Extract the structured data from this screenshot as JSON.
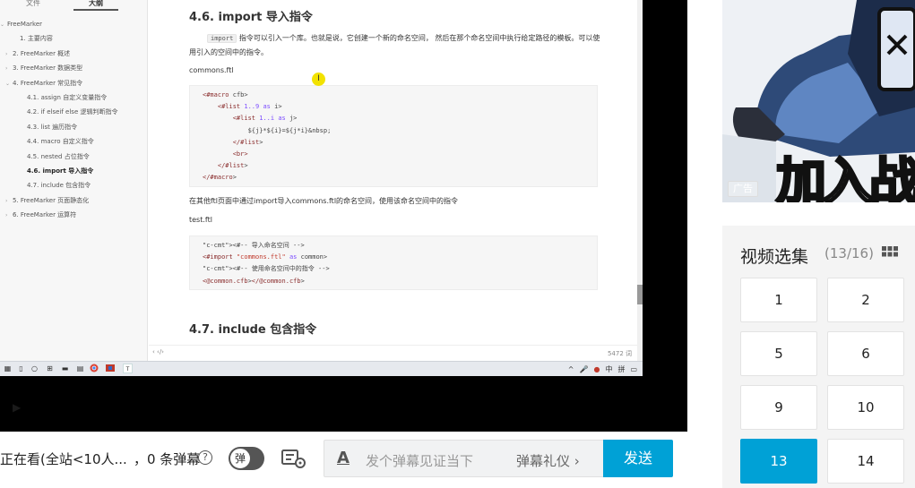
{
  "outline": {
    "tabs": [
      "文件",
      "大纲"
    ],
    "items": [
      {
        "label": "FreeMarker",
        "caret": "⌄"
      },
      {
        "label": "1. 主要内容",
        "caret": ""
      },
      {
        "label": "2. FreeMarker 概述",
        "caret": "›"
      },
      {
        "label": "3. FreeMarker 数据类型",
        "caret": "›"
      },
      {
        "label": "4. FreeMarker 常见指令",
        "caret": "⌄"
      },
      {
        "label": "4.1. assign 自定义变量指令",
        "caret": ""
      },
      {
        "label": "4.2. if elseif else 逻辑判断指令",
        "caret": ""
      },
      {
        "label": "4.3. list 遍历指令",
        "caret": ""
      },
      {
        "label": "4.4. macro 自定义指令",
        "caret": ""
      },
      {
        "label": "4.5. nested 占位指令",
        "caret": ""
      },
      {
        "label": "4.6. import 导入指令",
        "caret": ""
      },
      {
        "label": "4.7. include 包含指令",
        "caret": ""
      },
      {
        "label": "5. FreeMarker 页面静态化",
        "caret": "›"
      },
      {
        "label": "6. FreeMarker 运算符",
        "caret": "›"
      }
    ]
  },
  "doc": {
    "heading_import": "4.6. import 导入指令",
    "import_code_word": "import",
    "import_desc": " 指令可以引入一个库。也就是说，它创建一个新的命名空间， 然后在那个命名空间中执行给定路径的模板。可以使用引入的空间中的指令。",
    "file1": "commons.ftl",
    "code1": [
      "<#macro cfb>",
      "    <#list 1..9 as i>",
      "        <#list 1..i as j>",
      "            ${j}*${i}=${j*i}&nbsp;",
      "        </#list>",
      "        <br>",
      "    </#list>",
      "</#macro>"
    ],
    "usage_desc": "在其他ftl页面中通过import导入commons.ftl的命名空间，使用该命名空间中的指令",
    "file2": "test.ftl",
    "code2": [
      "<#-- 导入命名空间 -->",
      "<#import \"commons.ftl\" as common>",
      "<#-- 使用命名空间中的指令 -->",
      "<@common.cfb></@common.cfb>"
    ],
    "heading_include": "4.7. include 包含指令",
    "cursor_glyph": "I"
  },
  "statusbar": {
    "left": "‹   ‹/›",
    "words": "5472 词"
  },
  "taskbar": {
    "tray": [
      "^",
      "🎤",
      "●",
      "中",
      "拼",
      "▭"
    ]
  },
  "ad": {
    "banner": "加入战",
    "badge": "广告"
  },
  "episodes": {
    "title": "视频选集",
    "count": "(13/16)",
    "items": [
      "1",
      "2",
      "5",
      "6",
      "9",
      "10",
      "13",
      "14"
    ],
    "current": "13"
  },
  "danmaku": {
    "viewers": "正在看(全站<10人...",
    "count": "，0 条弹幕",
    "help": "?",
    "toggle_label": "弹",
    "style_icon": "A",
    "placeholder": "发个弹幕见证当下",
    "etiquette": "弹幕礼仪 ›",
    "send": "发送"
  },
  "colors": {
    "accent": "#00a1d6",
    "cursor_highlight": "#f2e200"
  }
}
